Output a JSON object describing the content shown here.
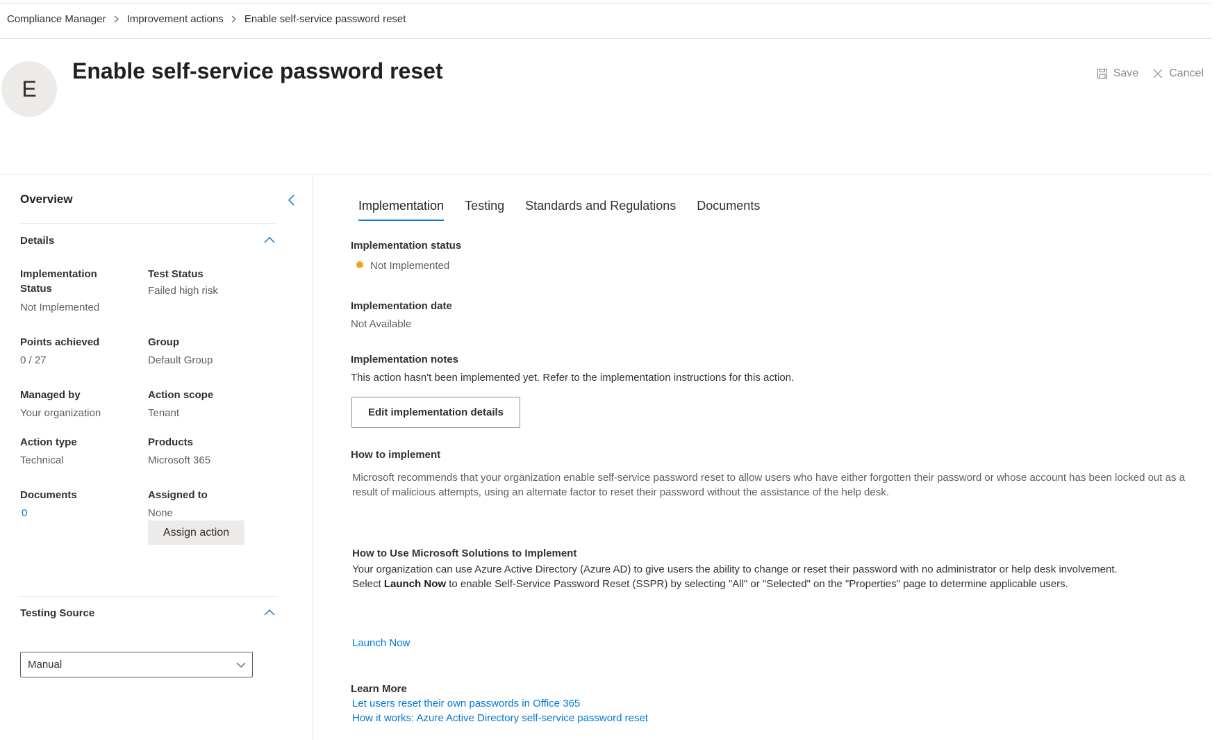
{
  "breadcrumb": [
    "Compliance Manager",
    "Improvement actions",
    "Enable self-service password reset"
  ],
  "header": {
    "avatar_letter": "E",
    "title": "Enable self-service password reset",
    "save_label": "Save",
    "cancel_label": "Cancel"
  },
  "overview": {
    "title": "Overview",
    "details": {
      "title": "Details",
      "implementation_status": {
        "label": "Implementation Status",
        "value": "Not Implemented"
      },
      "test_status": {
        "label": "Test Status",
        "value": "Failed high risk"
      },
      "points_achieved": {
        "label": "Points achieved",
        "value": "0 / 27"
      },
      "group": {
        "label": "Group",
        "value": "Default Group"
      },
      "managed_by": {
        "label": "Managed by",
        "value": "Your organization"
      },
      "action_scope": {
        "label": "Action scope",
        "value": "Tenant"
      },
      "action_type": {
        "label": "Action type",
        "value": "Technical"
      },
      "products": {
        "label": "Products",
        "value": "Microsoft 365"
      },
      "documents": {
        "label": "Documents",
        "value": "0"
      },
      "assigned_to": {
        "label": "Assigned to",
        "value": "None"
      },
      "assign_button": "Assign action"
    },
    "testing_source": {
      "title": "Testing Source",
      "selected": "Manual"
    }
  },
  "tabs": [
    "Implementation",
    "Testing",
    "Standards and Regulations",
    "Documents"
  ],
  "active_tab": "Implementation",
  "implementation": {
    "status_label": "Implementation status",
    "status_value": "Not Implemented",
    "status_color": "#f7a21a",
    "date_label": "Implementation date",
    "date_value": "Not Available",
    "notes_label": "Implementation notes",
    "notes_value": "This action hasn't been implemented yet. Refer to the implementation instructions for this action.",
    "edit_button": "Edit implementation details",
    "how_label": "How to implement",
    "how_text": "Microsoft recommends that your organization enable self-service password reset to allow users who have either forgotten their password or whose account has been locked out as a result of malicious attempts, using an alternate factor to reset their password without the assistance of the help desk.",
    "ms_label": "How to Use Microsoft Solutions to Implement",
    "ms_line1": "Your organization can use Azure Active Directory (Azure AD) to give users the ability to change or reset their password with no administrator or help desk involvement.",
    "ms_line2_prefix": "Select ",
    "ms_line2_bold": "Launch Now",
    "ms_line2_suffix": " to enable Self-Service Password Reset (SSPR) by selecting \"All\" or \"Selected\" on the \"Properties\" page to determine applicable users.",
    "launch_link": "Launch Now",
    "learn_more_label": "Learn More",
    "learn_links": [
      "Let users reset their own passwords in Office 365",
      "How it works: Azure Active Directory self-service password reset"
    ]
  },
  "colors": {
    "accent": "#0078d4",
    "status_orange": "#f7a21a"
  }
}
